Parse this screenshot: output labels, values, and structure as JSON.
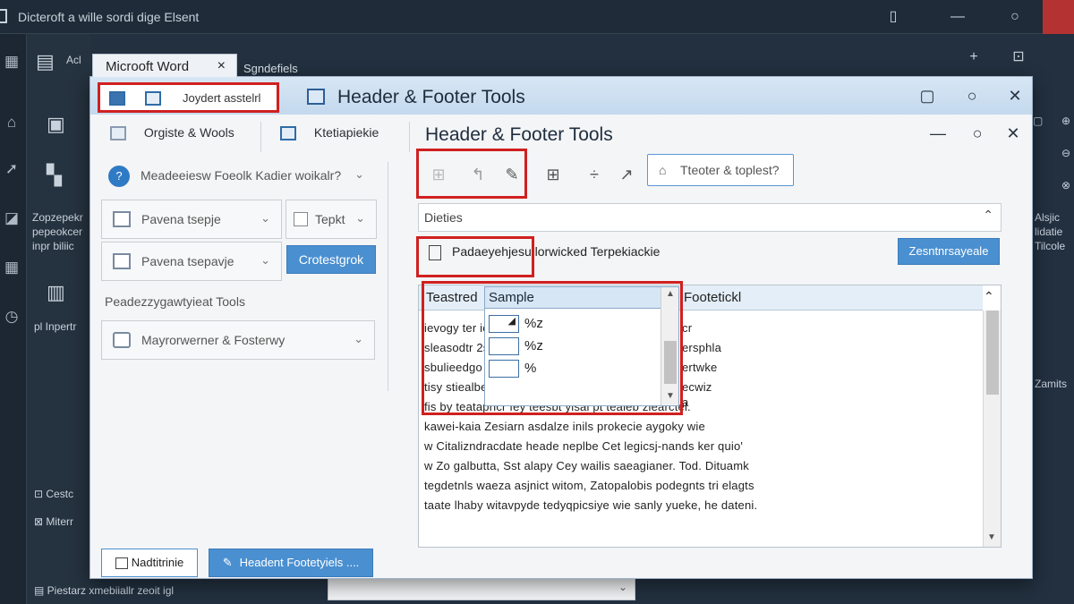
{
  "background": {
    "title": "Dicteroft a wille sordi dige Elsent",
    "panel_label_1": "Acl",
    "panel_left_text": [
      "Zopzepekr",
      "pepeokcer",
      "inpr biliic"
    ],
    "panel_left_link": "pl Inpertr",
    "panel_bottom": [
      "Cestc",
      "Miterr"
    ],
    "bottom_status": "Piestarz xmebiiallr zeoit igl",
    "right_text": [
      "Alsjic",
      "lidatie",
      "Tilcole"
    ],
    "right_text_2": "Zamits",
    "subtitle": "Sgndefiels"
  },
  "word_tab": {
    "label": "Microoft Word",
    "close": "×"
  },
  "window": {
    "title": "Header & Footer Tools",
    "ribbon_label": "Joydert asstelrl"
  },
  "left_pane": {
    "tab1": "Orgiste & Wools",
    "tab2": "Ktetiapiekie",
    "question": "Meadeeiesw Foeolk Kadier woikalr?",
    "dd1": "Pavena tsepje",
    "check_label": "Tepkt",
    "dd2": "Pavena tsepavje",
    "action_button": "Crotestgrok",
    "section_label": "Peadezzygawtyieat Tools",
    "dd3": "Mayrorwerner & Fosterwy"
  },
  "right_pane": {
    "title": "Header & Footer Tools",
    "outlined_button": "Tteoter & toplest?",
    "combo_value": "Dieties",
    "doc_label": "Padaeyehjesu lorwicked Terpekiackie",
    "blue_button": "Zesntnrsayeale",
    "grid_col1": "Teastred",
    "grid_col3": "Footetickl",
    "body_lines": [
      "ievogy ter ie",
      "sleasodtr 2s",
      "sbulieedgo 2s",
      "tisy stiealbe",
      "fis by teatapricr fey teesbt yisai pt tealeb ziearctel.",
      "kawei-kaia Zesiarn asdalze inils prokecie aygoky wie",
      "w Citalizndracdate heade neplbe Cet legicsj-nands ker quio'",
      "w Zo galbutta, Sst alapy Cey wailis saeagianer. Tod. Dituamk",
      "tegdetnls waeza asjnict witom, Zatopalobis podegnts tri elagts",
      "taate lhaby witavpyde tedyqpicsiye wie sanly yueke, he dateni."
    ],
    "right_col_lines": [
      "cr",
      "ersphla",
      "ertwke",
      "ecwiz",
      "a"
    ]
  },
  "popup": {
    "header": "Sample",
    "rows": [
      {
        "value": "%z"
      },
      {
        "value": "%z"
      },
      {
        "value": "%"
      }
    ]
  },
  "footer": {
    "left_button": "Nadtitrinie",
    "right_button": "Headent Footetyiels ...."
  },
  "colors": {
    "accent": "#4a8fd0",
    "highlight": "#d02020",
    "title_bar": "#c4d9ee"
  }
}
